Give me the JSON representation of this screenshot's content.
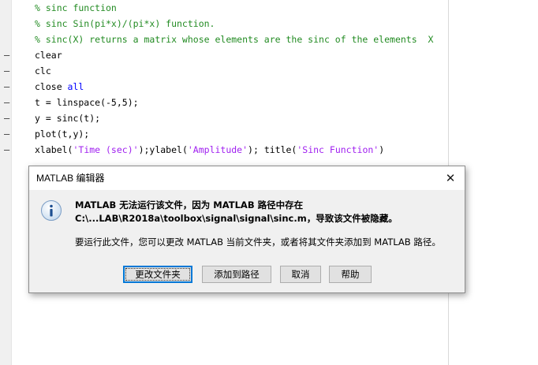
{
  "editor": {
    "lines": [
      {
        "dash": "",
        "segments": [
          {
            "text": "% sinc function",
            "style": "comment"
          }
        ]
      },
      {
        "dash": "",
        "segments": [
          {
            "text": "% sinc Sin(pi*x)/(pi*x) function.",
            "style": "comment"
          }
        ]
      },
      {
        "dash": "",
        "segments": [
          {
            "text": "% sinc(X) returns a matrix whose elements are the sinc of the elements  X",
            "style": "comment"
          }
        ]
      },
      {
        "dash": "–",
        "segments": [
          {
            "text": "clear",
            "style": "plain"
          }
        ]
      },
      {
        "dash": "–",
        "segments": [
          {
            "text": "clc",
            "style": "plain"
          }
        ]
      },
      {
        "dash": "–",
        "segments": [
          {
            "text": "close ",
            "style": "plain"
          },
          {
            "text": "all",
            "style": "keyword"
          }
        ]
      },
      {
        "dash": "–",
        "segments": [
          {
            "text": "t = linspace(-5,5);",
            "style": "plain"
          }
        ]
      },
      {
        "dash": "–",
        "segments": [
          {
            "text": "y = sinc(t);",
            "style": "plain"
          }
        ]
      },
      {
        "dash": "–",
        "segments": [
          {
            "text": "plot(t,y);",
            "style": "plain"
          }
        ]
      },
      {
        "dash": "–",
        "segments": [
          {
            "text": "xlabel(",
            "style": "plain"
          },
          {
            "text": "'Time (sec)'",
            "style": "string"
          },
          {
            "text": ");ylabel(",
            "style": "plain"
          },
          {
            "text": "'Amplitude'",
            "style": "string"
          },
          {
            "text": "); title(",
            "style": "plain"
          },
          {
            "text": "'Sinc Function'",
            "style": "string"
          },
          {
            "text": ")",
            "style": "plain"
          }
        ]
      }
    ]
  },
  "dialog": {
    "title": "MATLAB 编辑器",
    "close_glyph": "✕",
    "icon": "info-icon",
    "message_line1": "MATLAB 无法运行该文件，因为 MATLAB 路径中存在",
    "message_line2": "C:\\...LAB\\R2018a\\toolbox\\signal\\signal\\sinc.m，导致该文件被隐藏。",
    "message_line3": "要运行此文件，您可以更改 MATLAB 当前文件夹，或者将其文件夹添加到 MATLAB 路径。",
    "buttons": {
      "change_folder": "更改文件夹",
      "add_to_path": "添加到路径",
      "cancel": "取消",
      "help": "帮助"
    }
  },
  "colors": {
    "comment": "#228b22",
    "keyword": "#0000ff",
    "string": "#a020f0",
    "default_button_border": "#0078d7"
  }
}
